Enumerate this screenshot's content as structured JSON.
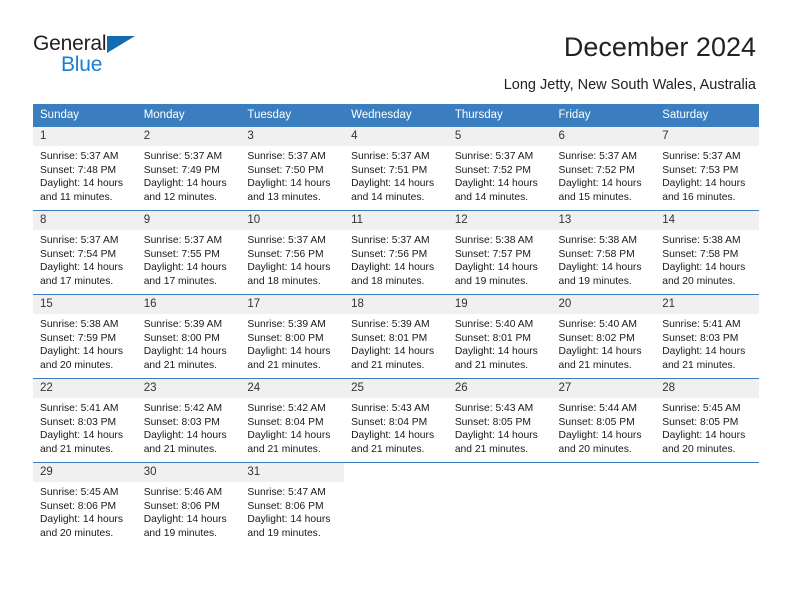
{
  "brand": {
    "name_top": "General",
    "name_bottom": "Blue",
    "accent_color": "#1a7fd4",
    "triangle_color": "#136cb2"
  },
  "header": {
    "title": "December 2024",
    "subtitle": "Long Jetty, New South Wales, Australia"
  },
  "theme": {
    "header_row_bg": "#3a7ebf",
    "header_row_text": "#ffffff",
    "daynum_bg": "#f0f0f0",
    "cell_bg": "#ffffff",
    "row_divider": "#3a7ebf"
  },
  "weekdays": [
    "Sunday",
    "Monday",
    "Tuesday",
    "Wednesday",
    "Thursday",
    "Friday",
    "Saturday"
  ],
  "labels": {
    "sunrise": "Sunrise:",
    "sunset": "Sunset:",
    "daylight": "Daylight:"
  },
  "weeks": [
    [
      {
        "day": "1",
        "sunrise": "Sunrise: 5:37 AM",
        "sunset": "Sunset: 7:48 PM",
        "daylight1": "Daylight: 14 hours",
        "daylight2": "and 11 minutes."
      },
      {
        "day": "2",
        "sunrise": "Sunrise: 5:37 AM",
        "sunset": "Sunset: 7:49 PM",
        "daylight1": "Daylight: 14 hours",
        "daylight2": "and 12 minutes."
      },
      {
        "day": "3",
        "sunrise": "Sunrise: 5:37 AM",
        "sunset": "Sunset: 7:50 PM",
        "daylight1": "Daylight: 14 hours",
        "daylight2": "and 13 minutes."
      },
      {
        "day": "4",
        "sunrise": "Sunrise: 5:37 AM",
        "sunset": "Sunset: 7:51 PM",
        "daylight1": "Daylight: 14 hours",
        "daylight2": "and 14 minutes."
      },
      {
        "day": "5",
        "sunrise": "Sunrise: 5:37 AM",
        "sunset": "Sunset: 7:52 PM",
        "daylight1": "Daylight: 14 hours",
        "daylight2": "and 14 minutes."
      },
      {
        "day": "6",
        "sunrise": "Sunrise: 5:37 AM",
        "sunset": "Sunset: 7:52 PM",
        "daylight1": "Daylight: 14 hours",
        "daylight2": "and 15 minutes."
      },
      {
        "day": "7",
        "sunrise": "Sunrise: 5:37 AM",
        "sunset": "Sunset: 7:53 PM",
        "daylight1": "Daylight: 14 hours",
        "daylight2": "and 16 minutes."
      }
    ],
    [
      {
        "day": "8",
        "sunrise": "Sunrise: 5:37 AM",
        "sunset": "Sunset: 7:54 PM",
        "daylight1": "Daylight: 14 hours",
        "daylight2": "and 17 minutes."
      },
      {
        "day": "9",
        "sunrise": "Sunrise: 5:37 AM",
        "sunset": "Sunset: 7:55 PM",
        "daylight1": "Daylight: 14 hours",
        "daylight2": "and 17 minutes."
      },
      {
        "day": "10",
        "sunrise": "Sunrise: 5:37 AM",
        "sunset": "Sunset: 7:56 PM",
        "daylight1": "Daylight: 14 hours",
        "daylight2": "and 18 minutes."
      },
      {
        "day": "11",
        "sunrise": "Sunrise: 5:37 AM",
        "sunset": "Sunset: 7:56 PM",
        "daylight1": "Daylight: 14 hours",
        "daylight2": "and 18 minutes."
      },
      {
        "day": "12",
        "sunrise": "Sunrise: 5:38 AM",
        "sunset": "Sunset: 7:57 PM",
        "daylight1": "Daylight: 14 hours",
        "daylight2": "and 19 minutes."
      },
      {
        "day": "13",
        "sunrise": "Sunrise: 5:38 AM",
        "sunset": "Sunset: 7:58 PM",
        "daylight1": "Daylight: 14 hours",
        "daylight2": "and 19 minutes."
      },
      {
        "day": "14",
        "sunrise": "Sunrise: 5:38 AM",
        "sunset": "Sunset: 7:58 PM",
        "daylight1": "Daylight: 14 hours",
        "daylight2": "and 20 minutes."
      }
    ],
    [
      {
        "day": "15",
        "sunrise": "Sunrise: 5:38 AM",
        "sunset": "Sunset: 7:59 PM",
        "daylight1": "Daylight: 14 hours",
        "daylight2": "and 20 minutes."
      },
      {
        "day": "16",
        "sunrise": "Sunrise: 5:39 AM",
        "sunset": "Sunset: 8:00 PM",
        "daylight1": "Daylight: 14 hours",
        "daylight2": "and 21 minutes."
      },
      {
        "day": "17",
        "sunrise": "Sunrise: 5:39 AM",
        "sunset": "Sunset: 8:00 PM",
        "daylight1": "Daylight: 14 hours",
        "daylight2": "and 21 minutes."
      },
      {
        "day": "18",
        "sunrise": "Sunrise: 5:39 AM",
        "sunset": "Sunset: 8:01 PM",
        "daylight1": "Daylight: 14 hours",
        "daylight2": "and 21 minutes."
      },
      {
        "day": "19",
        "sunrise": "Sunrise: 5:40 AM",
        "sunset": "Sunset: 8:01 PM",
        "daylight1": "Daylight: 14 hours",
        "daylight2": "and 21 minutes."
      },
      {
        "day": "20",
        "sunrise": "Sunrise: 5:40 AM",
        "sunset": "Sunset: 8:02 PM",
        "daylight1": "Daylight: 14 hours",
        "daylight2": "and 21 minutes."
      },
      {
        "day": "21",
        "sunrise": "Sunrise: 5:41 AM",
        "sunset": "Sunset: 8:03 PM",
        "daylight1": "Daylight: 14 hours",
        "daylight2": "and 21 minutes."
      }
    ],
    [
      {
        "day": "22",
        "sunrise": "Sunrise: 5:41 AM",
        "sunset": "Sunset: 8:03 PM",
        "daylight1": "Daylight: 14 hours",
        "daylight2": "and 21 minutes."
      },
      {
        "day": "23",
        "sunrise": "Sunrise: 5:42 AM",
        "sunset": "Sunset: 8:03 PM",
        "daylight1": "Daylight: 14 hours",
        "daylight2": "and 21 minutes."
      },
      {
        "day": "24",
        "sunrise": "Sunrise: 5:42 AM",
        "sunset": "Sunset: 8:04 PM",
        "daylight1": "Daylight: 14 hours",
        "daylight2": "and 21 minutes."
      },
      {
        "day": "25",
        "sunrise": "Sunrise: 5:43 AM",
        "sunset": "Sunset: 8:04 PM",
        "daylight1": "Daylight: 14 hours",
        "daylight2": "and 21 minutes."
      },
      {
        "day": "26",
        "sunrise": "Sunrise: 5:43 AM",
        "sunset": "Sunset: 8:05 PM",
        "daylight1": "Daylight: 14 hours",
        "daylight2": "and 21 minutes."
      },
      {
        "day": "27",
        "sunrise": "Sunrise: 5:44 AM",
        "sunset": "Sunset: 8:05 PM",
        "daylight1": "Daylight: 14 hours",
        "daylight2": "and 20 minutes."
      },
      {
        "day": "28",
        "sunrise": "Sunrise: 5:45 AM",
        "sunset": "Sunset: 8:05 PM",
        "daylight1": "Daylight: 14 hours",
        "daylight2": "and 20 minutes."
      }
    ],
    [
      {
        "day": "29",
        "sunrise": "Sunrise: 5:45 AM",
        "sunset": "Sunset: 8:06 PM",
        "daylight1": "Daylight: 14 hours",
        "daylight2": "and 20 minutes."
      },
      {
        "day": "30",
        "sunrise": "Sunrise: 5:46 AM",
        "sunset": "Sunset: 8:06 PM",
        "daylight1": "Daylight: 14 hours",
        "daylight2": "and 19 minutes."
      },
      {
        "day": "31",
        "sunrise": "Sunrise: 5:47 AM",
        "sunset": "Sunset: 8:06 PM",
        "daylight1": "Daylight: 14 hours",
        "daylight2": "and 19 minutes."
      },
      {
        "day": "",
        "sunrise": "",
        "sunset": "",
        "daylight1": "",
        "daylight2": ""
      },
      {
        "day": "",
        "sunrise": "",
        "sunset": "",
        "daylight1": "",
        "daylight2": ""
      },
      {
        "day": "",
        "sunrise": "",
        "sunset": "",
        "daylight1": "",
        "daylight2": ""
      },
      {
        "day": "",
        "sunrise": "",
        "sunset": "",
        "daylight1": "",
        "daylight2": ""
      }
    ]
  ]
}
